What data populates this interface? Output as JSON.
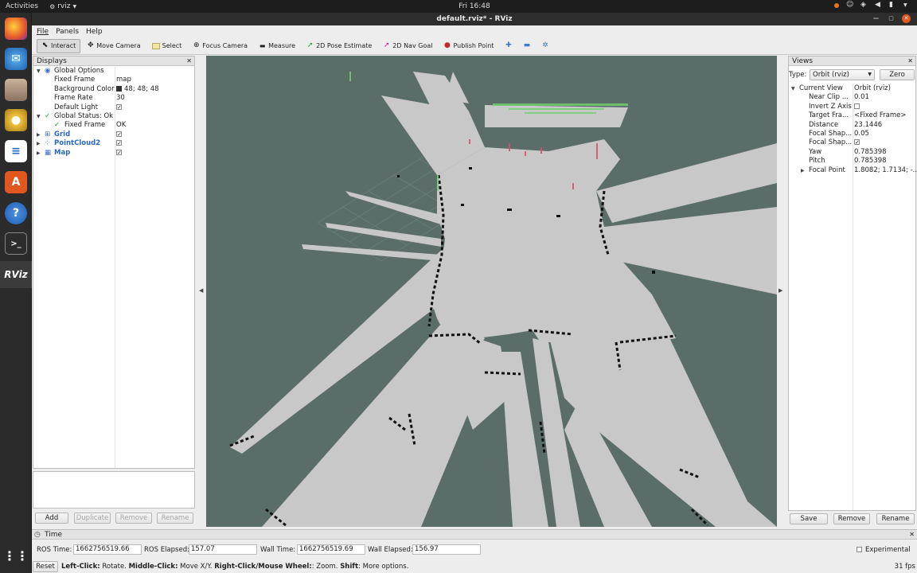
{
  "topbar": {
    "activities": "Activities",
    "app_name": "rviz",
    "clock": "Fri 16:48"
  },
  "window": {
    "title": "default.rviz* - RViz"
  },
  "menu": {
    "file": "File",
    "panels": "Panels",
    "help": "Help"
  },
  "toolbar": {
    "interact": "Interact",
    "move_camera": "Move Camera",
    "select": "Select",
    "focus_camera": "Focus Camera",
    "measure": "Measure",
    "pose_estimate": "2D Pose Estimate",
    "nav_goal": "2D Nav Goal",
    "publish_point": "Publish Point"
  },
  "displays": {
    "title": "Displays",
    "global_options": "Global Options",
    "fixed_frame_label": "Fixed Frame",
    "fixed_frame_value": "map",
    "bg_color_label": "Background Color",
    "bg_color_value": "48; 48; 48",
    "frame_rate_label": "Frame Rate",
    "frame_rate_value": "30",
    "default_light_label": "Default Light",
    "global_status": "Global Status: Ok",
    "gs_fixed_frame_label": "Fixed Frame",
    "gs_fixed_frame_value": "OK",
    "grid": "Grid",
    "pointcloud2": "PointCloud2",
    "map": "Map",
    "add": "Add",
    "duplicate": "Duplicate",
    "remove": "Remove",
    "rename": "Rename"
  },
  "views": {
    "title": "Views",
    "type_label": "Type:",
    "type_value": "Orbit (rviz)",
    "zero": "Zero",
    "current_view": "Current View",
    "current_view_value": "Orbit (rviz)",
    "near_clip_label": "Near Clip ...",
    "near_clip_value": "0.01",
    "invert_z_label": "Invert Z Axis",
    "target_frame_label": "Target Fra...",
    "target_frame_value": "<Fixed Frame>",
    "distance_label": "Distance",
    "distance_value": "23.1446",
    "focal_shape1_label": "Focal Shap...",
    "focal_shape1_value": "0.05",
    "focal_shape2_label": "Focal Shap...",
    "yaw_label": "Yaw",
    "yaw_value": "0.785398",
    "pitch_label": "Pitch",
    "pitch_value": "0.785398",
    "focal_point_label": "Focal Point",
    "focal_point_value": "1.8082; 1.7134; -...",
    "save": "Save",
    "remove": "Remove",
    "rename": "Rename"
  },
  "time": {
    "title": "Time",
    "ros_time_label": "ROS Time:",
    "ros_time_value": "1662756519.66",
    "ros_elapsed_label": "ROS Elapsed:",
    "ros_elapsed_value": "157.07",
    "wall_time_label": "Wall Time:",
    "wall_time_value": "1662756519.69",
    "wall_elapsed_label": "Wall Elapsed:",
    "wall_elapsed_value": "156.97",
    "experimental": "Experimental"
  },
  "status": {
    "reset": "Reset",
    "hint_1_key": "Left-Click:",
    "hint_1_val": " Rotate. ",
    "hint_2_key": "Middle-Click:",
    "hint_2_val": " Move X/Y. ",
    "hint_3_key": "Right-Click/Mouse Wheel:",
    "hint_3_val": ": Zoom. ",
    "hint_4_key": "Shift",
    "hint_4_val": ": More options.",
    "fps": "31 fps"
  },
  "dock_icons": [
    "firefox-icon",
    "thunderbird-icon",
    "files-icon",
    "rhythmbox-icon",
    "writer-icon",
    "software-icon",
    "help-icon",
    "terminal-icon",
    "rviz-icon",
    "apps-grid-icon"
  ],
  "colors": {
    "viewport_bg": "#5a6d69",
    "free_space": "#c8c8c8",
    "obstacle": "#111111",
    "accent_blue": "#2866c4"
  }
}
